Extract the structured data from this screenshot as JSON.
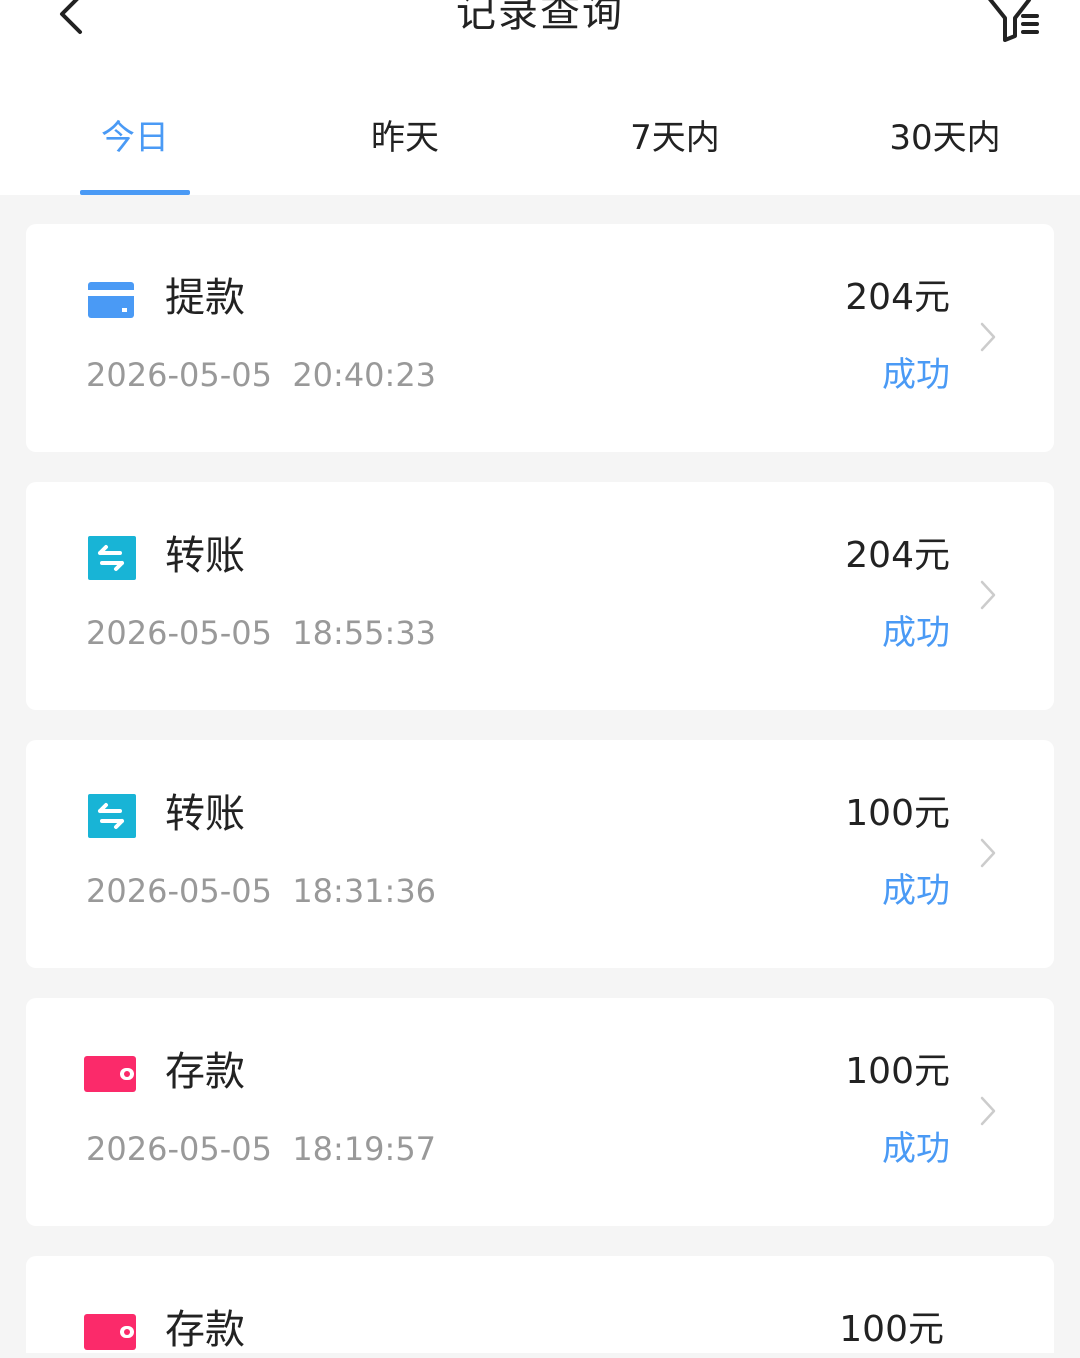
{
  "header": {
    "title": "记录查询"
  },
  "tabs": [
    {
      "label": "今日",
      "active": true
    },
    {
      "label": "昨天",
      "active": false
    },
    {
      "label": "7天内",
      "active": false
    },
    {
      "label": "30天内",
      "active": false
    }
  ],
  "colors": {
    "accent": "#4a9af5",
    "withdraw_icon": "#4a9af5",
    "transfer_icon": "#18b4d6",
    "deposit_icon": "#fb2a6a"
  },
  "records": [
    {
      "type": "提款",
      "icon": "card-icon",
      "datetime": "2026-05-05  20:40:23",
      "amount": "204元",
      "status": "成功"
    },
    {
      "type": "转账",
      "icon": "transfer-icon",
      "datetime": "2026-05-05  18:55:33",
      "amount": "204元",
      "status": "成功"
    },
    {
      "type": "转账",
      "icon": "transfer-icon",
      "datetime": "2026-05-05  18:31:36",
      "amount": "100元",
      "status": "成功"
    },
    {
      "type": "存款",
      "icon": "wallet-icon",
      "datetime": "2026-05-05  18:19:57",
      "amount": "100元",
      "status": "成功"
    },
    {
      "type": "存款",
      "icon": "wallet-icon",
      "datetime": "",
      "amount": "100元",
      "status": ""
    }
  ]
}
